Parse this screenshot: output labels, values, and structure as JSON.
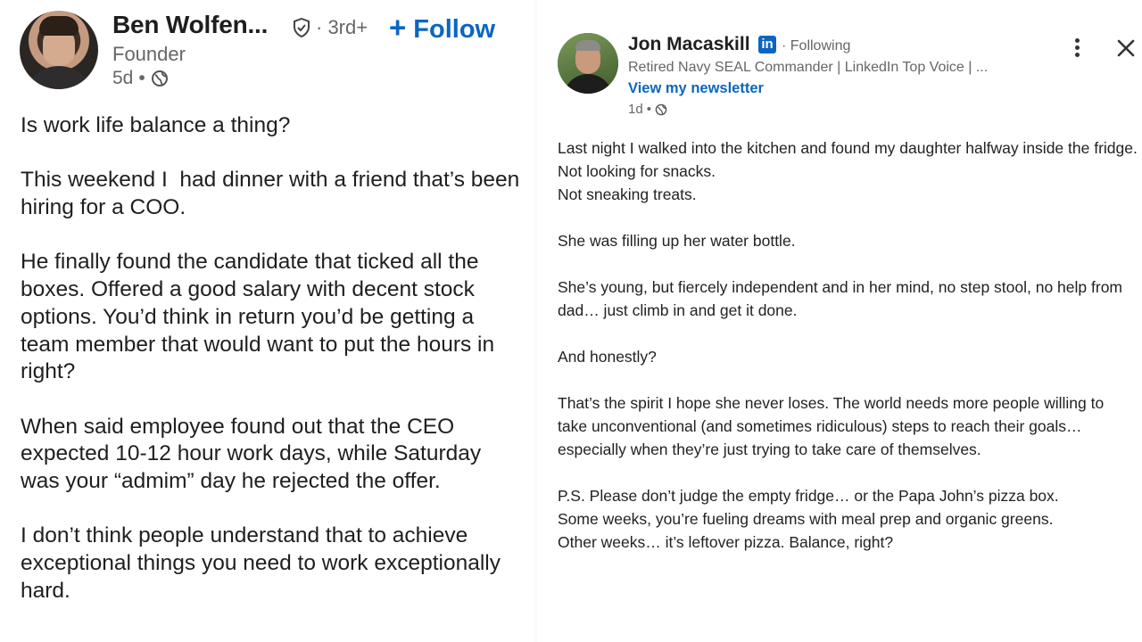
{
  "left_post": {
    "author_name": "Ben Wolfen...",
    "connection_degree": "· 3rd+",
    "follow_label": "Follow",
    "headline": "Founder",
    "timestamp": "5d",
    "meta_separator": "•",
    "paragraphs": [
      "Is work life balance a thing?",
      "This weekend I  had dinner with a friend that’s been hiring for a COO.",
      "He finally found the candidate that ticked all the boxes. Offered a good salary with decent stock options. You’d think in return you’d be getting a team member that would want to put the hours in right?",
      "When said employee found out that the CEO expected 10-12 hour work days, while Saturday was your “admim” day he rejected the offer.",
      "I don’t think people understand that to achieve exceptional things you need to work exceptionally hard."
    ],
    "icons": {
      "verified": "shield-check-icon",
      "visibility": "globe-icon"
    }
  },
  "right_post": {
    "author_name": "Jon Macaskill",
    "linkedin_badge": "in",
    "following_label": "· Following",
    "headline": "Retired Navy SEAL Commander | LinkedIn Top Voice | ...",
    "newsletter_link": "View my newsletter",
    "timestamp": "1d",
    "meta_separator": "•",
    "paragraphs": [
      [
        "Last night I walked into the kitchen and found my daughter halfway inside the fridge.",
        "Not looking for snacks.",
        "Not sneaking treats."
      ],
      [
        "She was filling up her water bottle."
      ],
      [
        "She’s young, but fiercely independent and in her mind, no step stool, no help from dad… just climb in and get it done."
      ],
      [
        "And honestly?"
      ],
      [
        "That’s the spirit I hope she never loses. The world needs more people willing to take unconventional (and sometimes ridiculous) steps to reach their goals… especially when they’re just trying to take care of themselves."
      ],
      [
        "P.S. Please don’t judge the empty fridge… or the Papa John’s pizza box.",
        "Some weeks, you’re fueling dreams with meal prep and organic greens.",
        "Other weeks… it’s leftover pizza. Balance, right?"
      ]
    ],
    "icons": {
      "more": "more-vertical-icon",
      "close": "close-icon",
      "visibility": "globe-icon"
    }
  },
  "colors": {
    "link_blue": "#0a66c2",
    "secondary_text": "#666666",
    "primary_text": "#1f1f1f"
  }
}
